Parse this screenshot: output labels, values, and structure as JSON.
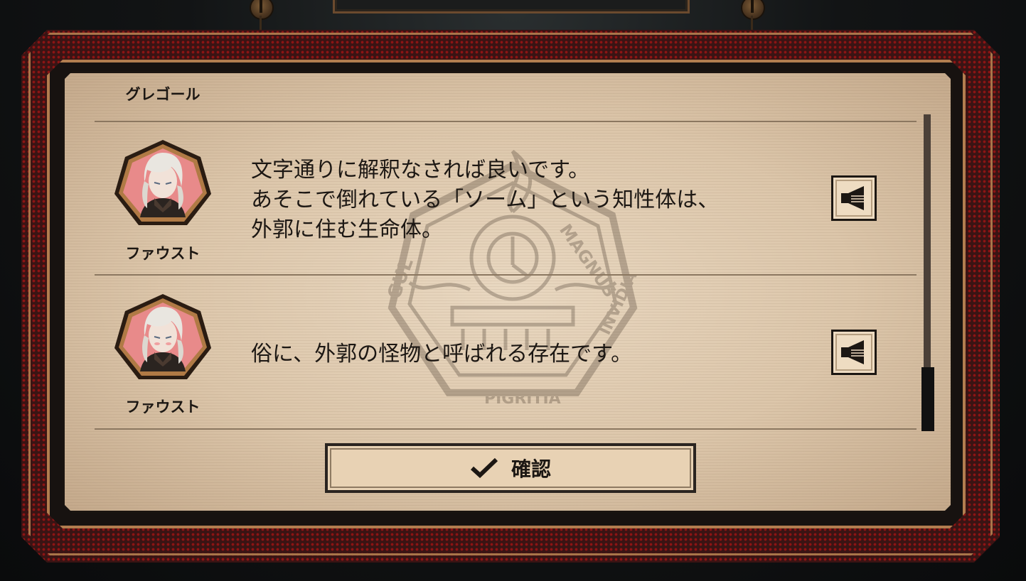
{
  "dialog_log": {
    "previous_speaker": "グレゴール",
    "entries": [
      {
        "speaker": "ファウスト",
        "portrait": "faust-portrait",
        "text": "文字通りに解釈なされば良いです。\nあそこで倒れている「ソーム」という知性体は、\n外郭に住む生命体。",
        "voice_icon": "speaker-icon"
      },
      {
        "speaker": "ファウスト",
        "portrait": "faust-portrait",
        "text": "俗に、外郭の怪物と呼ばれる存在です。",
        "voice_icon": "speaker-icon"
      }
    ],
    "confirm_label": "確認",
    "confirm_icon": "checkmark-icon"
  },
  "colors": {
    "paper": "#dcc6aa",
    "frame_brown": "#b27d4f",
    "frame_red": "#961414",
    "text": "#1c1713",
    "portrait_bg": "#e88a8a"
  }
}
